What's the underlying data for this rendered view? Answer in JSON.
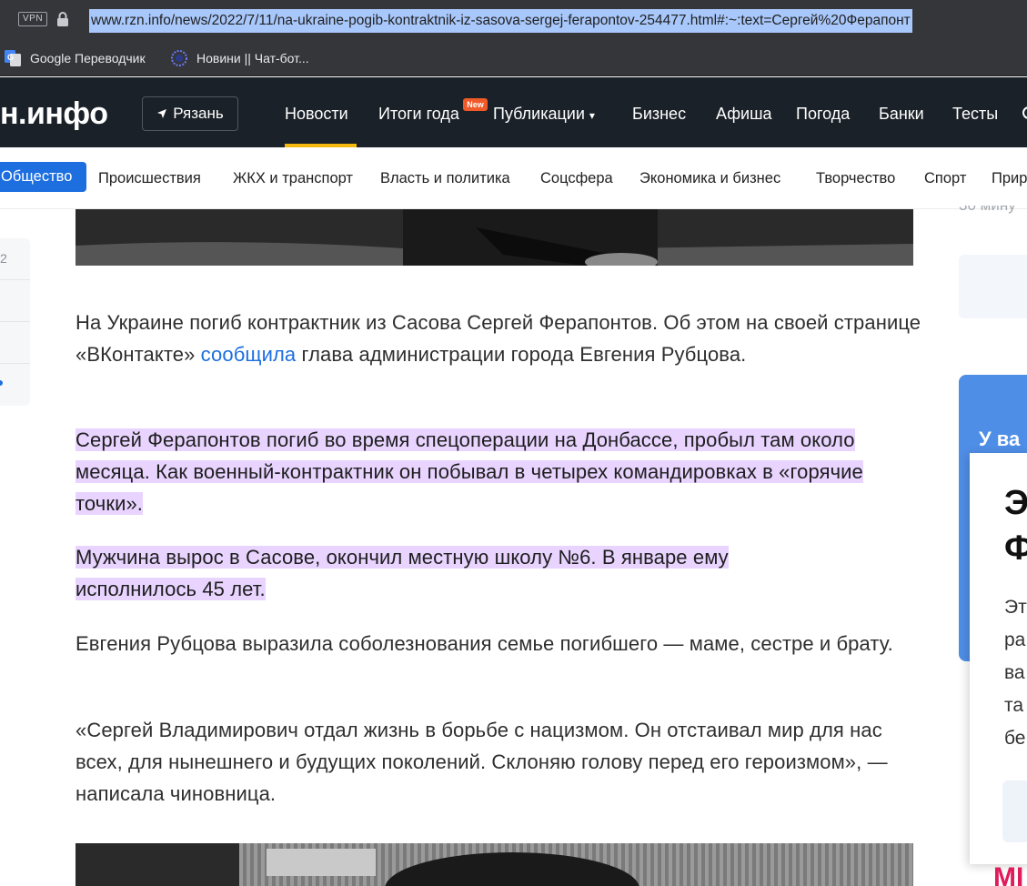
{
  "browser": {
    "vpn_label": "VPN",
    "url": "www.rzn.info/news/2022/7/11/na-ukraine-pogib-kontraktnik-iz-sasova-sergej-ferapontov-254477.html#:~:text=Сергей%20Ферапонт",
    "bookmarks": [
      {
        "label": "Google Переводчик",
        "icon": "google-translate-icon"
      },
      {
        "label": "Новини || Чат-бот...",
        "icon": "ukraine-emblem-icon"
      }
    ]
  },
  "site": {
    "logo": "н.инфо",
    "city": "Рязань",
    "nav": [
      "Новости",
      "Итоги года",
      "Публикации",
      "Бизнес",
      "Афиша",
      "Погода",
      "Банки",
      "Тесты"
    ],
    "new_badge": "New",
    "subnav": [
      "Общество",
      "Происшествия",
      "ЖКХ и транспорт",
      "Власть и политика",
      "Соцсфера",
      "Экономика и бизнес",
      "Творчество",
      "Спорт",
      "Прир"
    ]
  },
  "article": {
    "p1_a": "На Украине погиб контрактник из Сасова Сергей Ферапонтов. Об этом на своей странице «ВКонтакте» ",
    "p1_link": "сообщила",
    "p1_b": " глава администрации города Евгения Рубцова.",
    "p2": "Сергей Ферапонтов погиб во время спецоперации на Донбассе, пробыл там около месяца. Как военный-контрактник он побывал в четырех командировках в «горячие точки».",
    "p3": "Мужчина вырос в Сасове, окончил местную школу №6. В январе ему исполнилось 45 лет.",
    "p4": "Евгения Рубцова выразила соболезнования семье погибшего — маме, сестре и брату.",
    "p5": "«Сергей Владимирович отдал жизнь в борьбе с нацизмом. Он отстаивал мир для нас всех, для нынешнего и будущих поколений. Склоняю голову перед его героизмом», — написала чиновница."
  },
  "left_edge": {
    "number": "2"
  },
  "sidebar": {
    "time": "30 мину",
    "promo_text": "У ва",
    "popup_title_1": "Э",
    "popup_title_2": "Ф",
    "popup_lines": [
      "Эт",
      "ра",
      "ва",
      "та",
      "бе"
    ],
    "corner_text": "МІ"
  }
}
